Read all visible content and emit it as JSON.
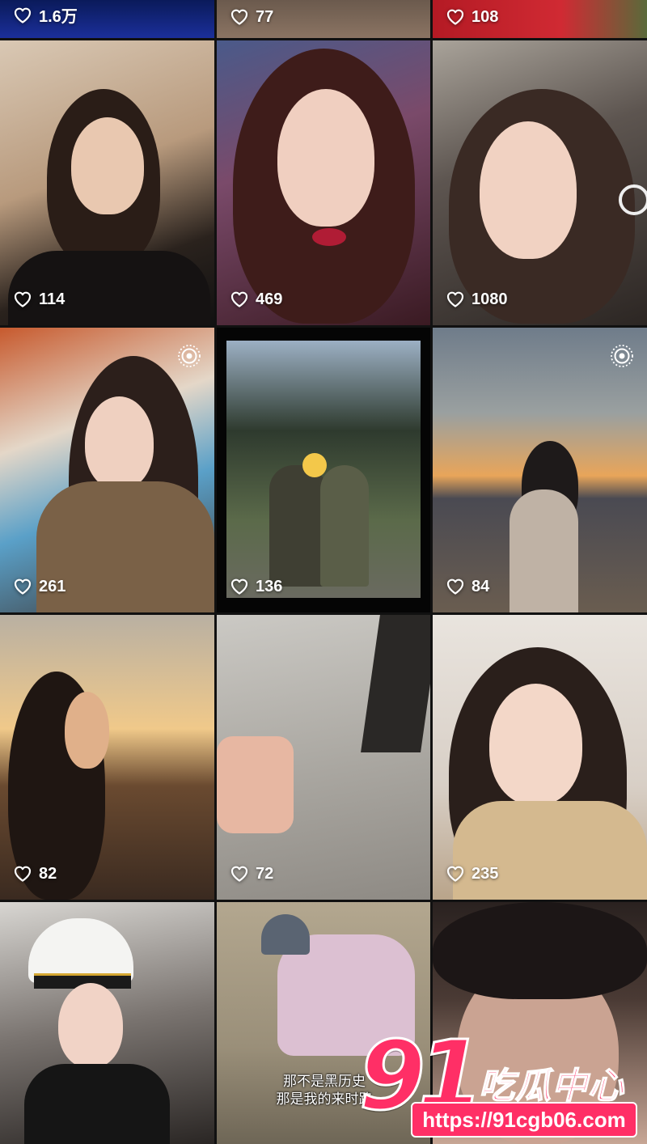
{
  "feed": {
    "tiles": [
      {
        "likes": "1.6万",
        "live": false
      },
      {
        "likes": "77",
        "live": false
      },
      {
        "likes": "108",
        "live": false
      },
      {
        "likes": "114",
        "live": false
      },
      {
        "likes": "469",
        "live": false
      },
      {
        "likes": "1080",
        "live": false
      },
      {
        "likes": "261",
        "live": true
      },
      {
        "likes": "136",
        "live": false
      },
      {
        "likes": "84",
        "live": true
      },
      {
        "likes": "82",
        "live": false
      },
      {
        "likes": "72",
        "live": false
      },
      {
        "likes": "235",
        "live": false
      },
      {
        "likes": "",
        "live": false
      },
      {
        "likes": "",
        "live": false
      },
      {
        "likes": "",
        "live": false
      }
    ],
    "subtitle_line1": "那不是黑历史",
    "subtitle_line2": "那是我的来时路"
  },
  "watermark": {
    "number": "91",
    "title": "吃瓜中心",
    "url": "https://91cgb06.com",
    "color": "#ff2f66"
  }
}
